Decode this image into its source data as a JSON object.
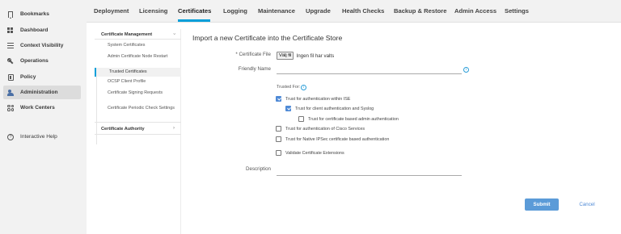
{
  "left_nav": {
    "items": [
      {
        "label": "Bookmarks",
        "icon": "bookmark-icon"
      },
      {
        "label": "Dashboard",
        "icon": "dashboard-icon"
      },
      {
        "label": "Context Visibility",
        "icon": "context-visibility-icon"
      },
      {
        "label": "Operations",
        "icon": "wrench-icon"
      },
      {
        "label": "Policy",
        "icon": "policy-icon"
      },
      {
        "label": "Administration",
        "icon": "administration-icon",
        "active": true
      },
      {
        "label": "Work Centers",
        "icon": "work-centers-icon"
      }
    ],
    "help": {
      "label": "Interactive Help",
      "icon": "help-icon"
    }
  },
  "tabs": [
    {
      "label": "Deployment"
    },
    {
      "label": "Licensing"
    },
    {
      "label": "Certificates",
      "active": true
    },
    {
      "label": "Logging"
    },
    {
      "label": "Maintenance"
    },
    {
      "label": "Upgrade"
    },
    {
      "label": "Health Checks"
    },
    {
      "label": "Backup & Restore"
    },
    {
      "label": "Admin Access"
    },
    {
      "label": "Settings"
    }
  ],
  "submenu": {
    "cert_mgmt_heading": "Certificate Management",
    "items": [
      {
        "label": "System Certificates"
      },
      {
        "label": "Admin Certificate Node Restart"
      },
      {
        "label": "Trusted Certificates",
        "active": true
      },
      {
        "label": "OCSP Client Profile"
      },
      {
        "label": "Certificate Signing Requests"
      },
      {
        "label": "Certificate Periodic Check Settings"
      }
    ],
    "cert_authority_heading": "Certificate Authority"
  },
  "form": {
    "title": "Import a new Certificate into the Certificate Store",
    "certificate_file_label": "* Certificate File",
    "file_button_label": "Välj fil",
    "file_status": "Ingen fil har valts",
    "friendly_name_label": "Friendly Name",
    "friendly_name_value": "",
    "trusted_for_label": "Trusted For:",
    "checkboxes": [
      {
        "label": "Trust for authentication within ISE",
        "checked": true
      },
      {
        "label": "Trust for client authentication and Syslog",
        "checked": true
      },
      {
        "label": "Trust for certificate based admin authentication",
        "checked": false
      },
      {
        "label": "Trust for authentication of Cisco Services",
        "checked": false
      },
      {
        "label": "Trust for Native IPSec certificate based authentication",
        "checked": false
      },
      {
        "label": "Validate Certificate Extensions",
        "checked": false
      }
    ],
    "description_label": "Description",
    "description_value": "",
    "submit_label": "Submit",
    "cancel_label": "Cancel"
  },
  "colors": {
    "accent": "#049fd9",
    "checkbox_checked": "#4f8ad6",
    "submit_button": "#5b9bd8",
    "nav_background": "#f2f2f2"
  }
}
